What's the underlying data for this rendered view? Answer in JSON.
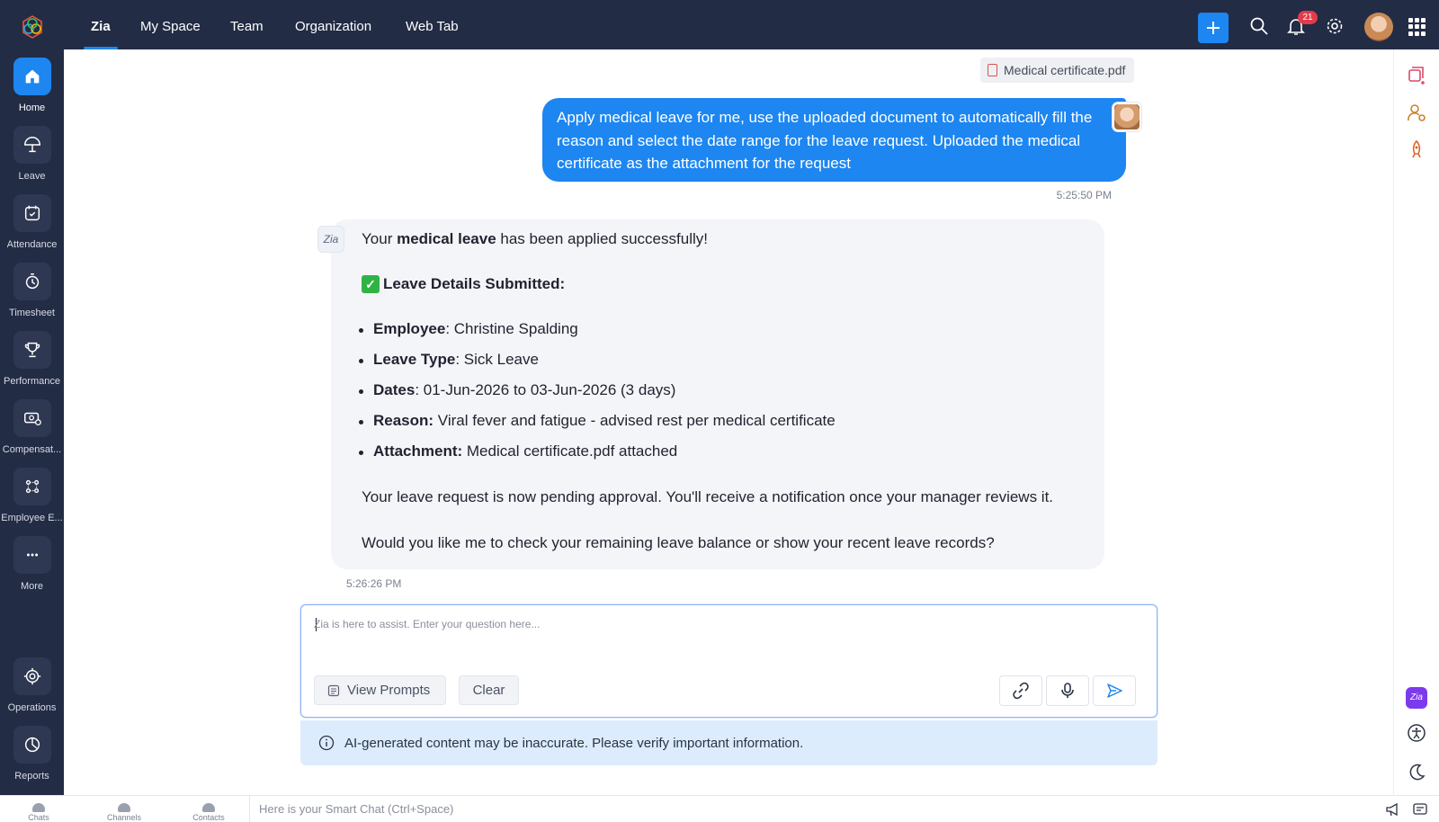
{
  "colors": {
    "sidebar_bg": "#232c45",
    "accent": "#1d86f0",
    "bot_bubble_bg": "#f4f5f8",
    "disclaimer_bg": "#dcecfd",
    "notif_badge": "#e23b4a"
  },
  "sidebar": {
    "logo_icon": "app-logo-icon",
    "items": [
      {
        "label": "Home",
        "icon": "home-icon",
        "active": true
      },
      {
        "label": "Leave",
        "icon": "umbrella-icon"
      },
      {
        "label": "Attendance",
        "icon": "calendar-check-icon"
      },
      {
        "label": "Timesheet",
        "icon": "stopwatch-icon"
      },
      {
        "label": "Performance",
        "icon": "trophy-icon"
      },
      {
        "label": "Compensat...",
        "icon": "money-settings-icon"
      },
      {
        "label": "Employee E...",
        "icon": "engagement-icon"
      },
      {
        "label": "More",
        "icon": "more-dots-icon"
      },
      {
        "label": "Operations",
        "icon": "operations-icon"
      },
      {
        "label": "Reports",
        "icon": "pie-chart-icon"
      }
    ]
  },
  "topbar": {
    "tabs": [
      {
        "label": "Zia",
        "active": true
      },
      {
        "label": "My Space"
      },
      {
        "label": "Team"
      },
      {
        "label": "Organization"
      },
      {
        "label": "Web Tab"
      }
    ],
    "notification_count": "21",
    "icons": [
      "add-icon",
      "search-icon",
      "bell-icon",
      "gear-icon",
      "user-avatar",
      "apps-grid-icon"
    ]
  },
  "right_rail": {
    "icons": [
      "add-request-icon",
      "user-settings-icon",
      "rocket-icon",
      "zia-icon",
      "accessibility-icon",
      "dark-mode-icon"
    ]
  },
  "chat": {
    "attachment_name": "Medical certificate.pdf",
    "user_message": "Apply medical leave for me, use the uploaded document to automatically fill the reason and select the date range for the leave request. Uploaded the medical certificate as the attachment for the request",
    "user_time": "5:25:50 PM",
    "bot": {
      "avatar_text": "Zia",
      "intro_before": "Your ",
      "intro_bold": "medical leave",
      "intro_after": " has been applied successfully!",
      "details_heading": "Leave Details Submitted:",
      "details": [
        {
          "key": "Employee",
          "value": ": Christine Spalding"
        },
        {
          "key": "Leave Type",
          "value": ": Sick Leave"
        },
        {
          "key": "Dates",
          "value": ": 01-Jun-2026 to 03-Jun-2026 (3 days)"
        },
        {
          "key": "Reason:",
          "value": " Viral fever and fatigue - advised rest per medical certificate"
        },
        {
          "key": "Attachment:",
          "value": " Medical certificate.pdf attached"
        }
      ],
      "pending_text": "Your leave request is now pending approval. You'll receive a notification once your manager reviews it.",
      "question_text": "Would you like me to check your remaining leave balance or show your recent leave records?",
      "time": "5:26:26 PM"
    }
  },
  "composer": {
    "placeholder": "Zia is here to assist. Enter your question here...",
    "value": "",
    "view_prompts_label": "View Prompts",
    "clear_label": "Clear",
    "tool_icons": [
      "link-icon",
      "microphone-icon",
      "send-icon"
    ]
  },
  "disclaimer": "AI-generated content may be inaccurate. Please verify important information.",
  "bottom_bar": {
    "items": [
      "Chats",
      "Channels",
      "Contacts"
    ],
    "smart_chat_placeholder": "Here is your Smart Chat (Ctrl+Space)",
    "right_icons": [
      "megaphone-icon",
      "chat-window-icon"
    ]
  }
}
